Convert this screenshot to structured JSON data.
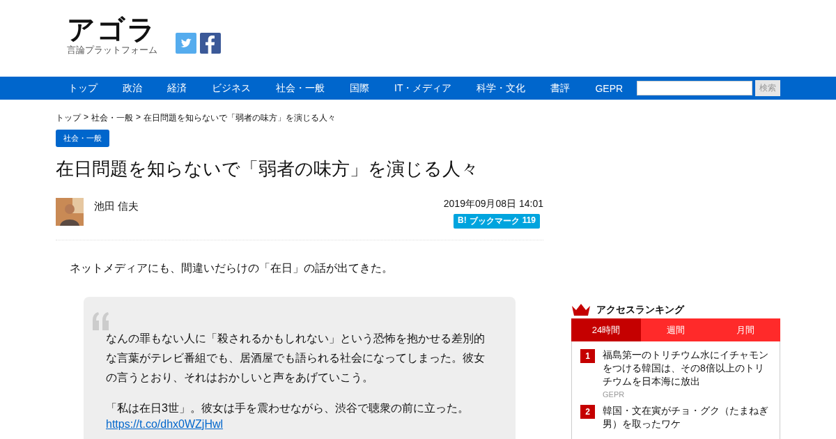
{
  "logo": {
    "title": "アゴラ",
    "subtitle": "言論プラットフォーム"
  },
  "nav": {
    "items": [
      {
        "label": "トップ"
      },
      {
        "label": "政治"
      },
      {
        "label": "経済"
      },
      {
        "label": "ビジネス"
      },
      {
        "label": "社会・一般"
      },
      {
        "label": "国際"
      },
      {
        "label": "IT・メディア"
      },
      {
        "label": "科学・文化"
      },
      {
        "label": "書評"
      },
      {
        "label": "GEPR"
      }
    ],
    "search_button": "検索"
  },
  "breadcrumb": [
    {
      "label": "トップ"
    },
    {
      "label": "社会・一般"
    },
    {
      "label": "在日問題を知らないで「弱者の味方」を演じる人々"
    }
  ],
  "breadcrumb_separator": ">",
  "category": "社会・一般",
  "article": {
    "title": "在日問題を知らないで「弱者の味方」を演じる人々",
    "author": "池田 信夫",
    "date": "2019年09月08日 14:01",
    "bookmark": {
      "icon": "B!",
      "label": "ブックマーク",
      "count": "119"
    },
    "lead": "ネットメディアにも、間違いだらけの「在日」の話が出てきた。",
    "quote": {
      "paragraphs": [
        "なんの罪もない人に「殺されるかもしれない」という恐怖を抱かせる差別的な言葉がテレビ番組でも、居酒屋でも語られる社会になってしまった。彼女の言うとおり、それはおかしいと声をあげていこう。",
        "「私は在日3世」。彼女は手を震わせながら、渋谷で聴衆の前に立った。"
      ],
      "link": "https://t.co/dhx0WZjHwl"
    }
  },
  "ranking": {
    "title": "アクセスランキング",
    "tabs": [
      {
        "label": "24時間",
        "selected": true
      },
      {
        "label": "週間",
        "selected": false
      },
      {
        "label": "月間",
        "selected": false
      }
    ],
    "items": [
      {
        "rank": "1",
        "title": "福島第一のトリチウム水にイチャモンをつける韓国は、その8倍以上のトリチウムを日本海に放出",
        "source": "GEPR"
      },
      {
        "rank": "2",
        "title": "韓国・文在寅がチョ・グク（たまねぎ男）を取ったワケ"
      }
    ]
  }
}
